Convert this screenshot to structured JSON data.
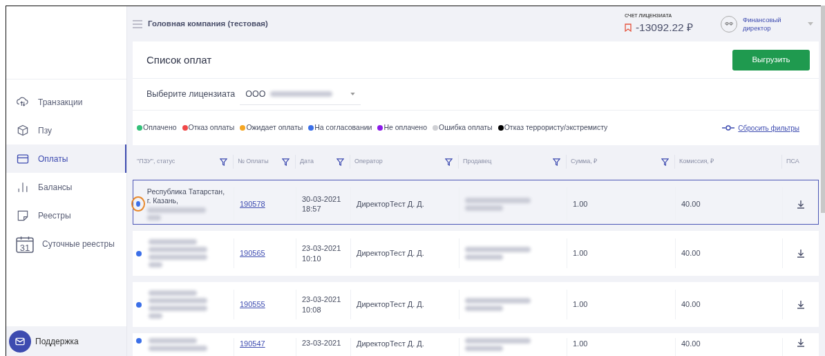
{
  "sidebar": {
    "items": [
      {
        "label": "Транзакции",
        "kind": "cloud",
        "selected": false
      },
      {
        "label": "Пзу",
        "kind": "cube",
        "selected": false
      },
      {
        "label": "Оплаты",
        "kind": "card",
        "selected": true
      },
      {
        "label": "Балансы",
        "kind": "bars",
        "selected": false
      },
      {
        "label": "Реестры",
        "kind": "note",
        "selected": false
      },
      {
        "label": "Суточные реестры",
        "kind": "calendar",
        "icon_text": "31",
        "selected": false
      }
    ],
    "support": {
      "label": "Поддержка"
    }
  },
  "header": {
    "company": "Головная компания (тестовая)",
    "account_label": "СЧЕТ ЛИЦЕНЗИАТА",
    "balance": "-13092.22 ₽",
    "user_initials": "ФФ",
    "user_name": "Финансовый директор"
  },
  "page": {
    "title": "Список оплат",
    "export_button": "Выгрузить",
    "licensee_label": "Выберите лицензиата",
    "licensee_value": "ООО",
    "legend": [
      {
        "label": "Оплачено",
        "color": "#34c07a"
      },
      {
        "label": "Отказ оплаты",
        "color": "#f04848"
      },
      {
        "label": "Ожидает оплаты",
        "color": "#f5a623"
      },
      {
        "label": "На согласовании",
        "color": "#3b6fe8"
      },
      {
        "label": "Не оплачено",
        "color": "#8b1ae8"
      },
      {
        "label": "Ошибка оплаты",
        "color": "#cfd0d4"
      },
      {
        "label": "Отказ террористу/экстремисту",
        "color": "#000000"
      }
    ],
    "reset_filters": "Сбросить фильтры"
  },
  "table": {
    "columns": [
      {
        "label": "\"ПЗУ\", статус",
        "filter": true
      },
      {
        "label": "№ Оплаты",
        "filter": true
      },
      {
        "label": "Дата",
        "filter": true
      },
      {
        "label": "Оператор",
        "filter": true
      },
      {
        "label": "Продавец",
        "filter": true
      },
      {
        "label": "Сумма, ₽",
        "filter": true
      },
      {
        "label": "Комиссия, ₽",
        "filter": false
      },
      {
        "label": "ПСА",
        "filter": false
      }
    ],
    "rows": [
      {
        "selected": true,
        "color": "#3b6fe8",
        "address": "Республика Татарстан, г. Казань,",
        "number": "190578",
        "date": "30-03-2021",
        "time": "18:57",
        "operator": "ДиректорТест Д. Д.",
        "amount": "1.00",
        "commission": "40.00"
      },
      {
        "selected": false,
        "color": "#3b6fe8",
        "number": "190565",
        "date": "23-03-2021",
        "time": "10:10",
        "operator": "ДиректорТест Д. Д.",
        "amount": "1.00",
        "commission": "40.00"
      },
      {
        "selected": false,
        "color": "#3b6fe8",
        "number": "190555",
        "date": "23-03-2021",
        "time": "10:08",
        "operator": "ДиректорТест Д. Д.",
        "amount": "1.00",
        "commission": "40.00"
      },
      {
        "selected": false,
        "color": "#3b6fe8",
        "number": "190547",
        "date": "23-03-2021",
        "operator": "ДиректорТест Д. Д.",
        "amount": "1.00",
        "commission": "40.00"
      }
    ]
  }
}
